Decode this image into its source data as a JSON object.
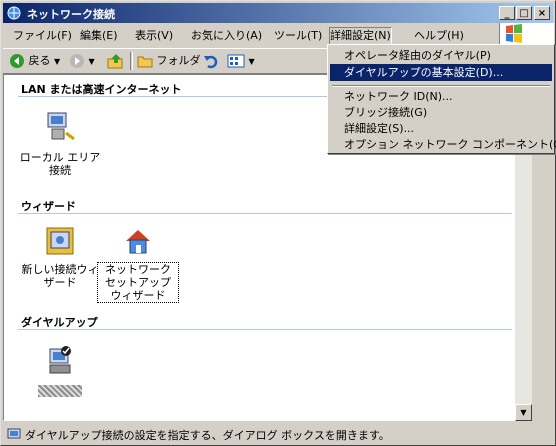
{
  "window": {
    "title": "ネットワーク接続"
  },
  "menubar": {
    "items": [
      {
        "label": "ファイル(F)"
      },
      {
        "label": "編集(E)"
      },
      {
        "label": "表示(V)"
      },
      {
        "label": "お気に入り(A)"
      },
      {
        "label": "ツール(T)"
      },
      {
        "label": "詳細設定(N)"
      },
      {
        "label": "ヘルプ(H)"
      }
    ]
  },
  "toolbar": {
    "back_label": "戻る",
    "folders_label": "フォルダ"
  },
  "groups": [
    {
      "title": "LAN または高速インターネット",
      "items": [
        {
          "label": "ローカル エリア 接続",
          "icon": "lan-connection-icon"
        }
      ]
    },
    {
      "title": "ウィザード",
      "items": [
        {
          "label": "新しい接続ウィザード",
          "icon": "new-connection-wizard-icon"
        },
        {
          "label": "ネットワーク セットアップ ウィザード",
          "icon": "network-setup-wizard-icon"
        }
      ]
    },
    {
      "title": "ダイヤルアップ",
      "items": [
        {
          "label": "",
          "icon": "dialup-connection-icon"
        }
      ]
    }
  ],
  "dropdown": {
    "items": [
      {
        "label": "オペレータ経由のダイヤル(P)"
      },
      {
        "label": "ダイヤルアップの基本設定(D)..."
      },
      {
        "label": "ネットワーク ID(N)..."
      },
      {
        "label": "ブリッジ接続(G)"
      },
      {
        "label": "詳細設定(S)..."
      },
      {
        "label": "オプション ネットワーク コンポーネント(O)..."
      }
    ]
  },
  "status": {
    "text": "ダイヤルアップ接続の設定を指定する、ダイアログ ボックスを開きます。"
  },
  "colors": {
    "titlebar_start": "#0a246a",
    "titlebar_end": "#a6caf0",
    "highlight": "#0a246a"
  }
}
